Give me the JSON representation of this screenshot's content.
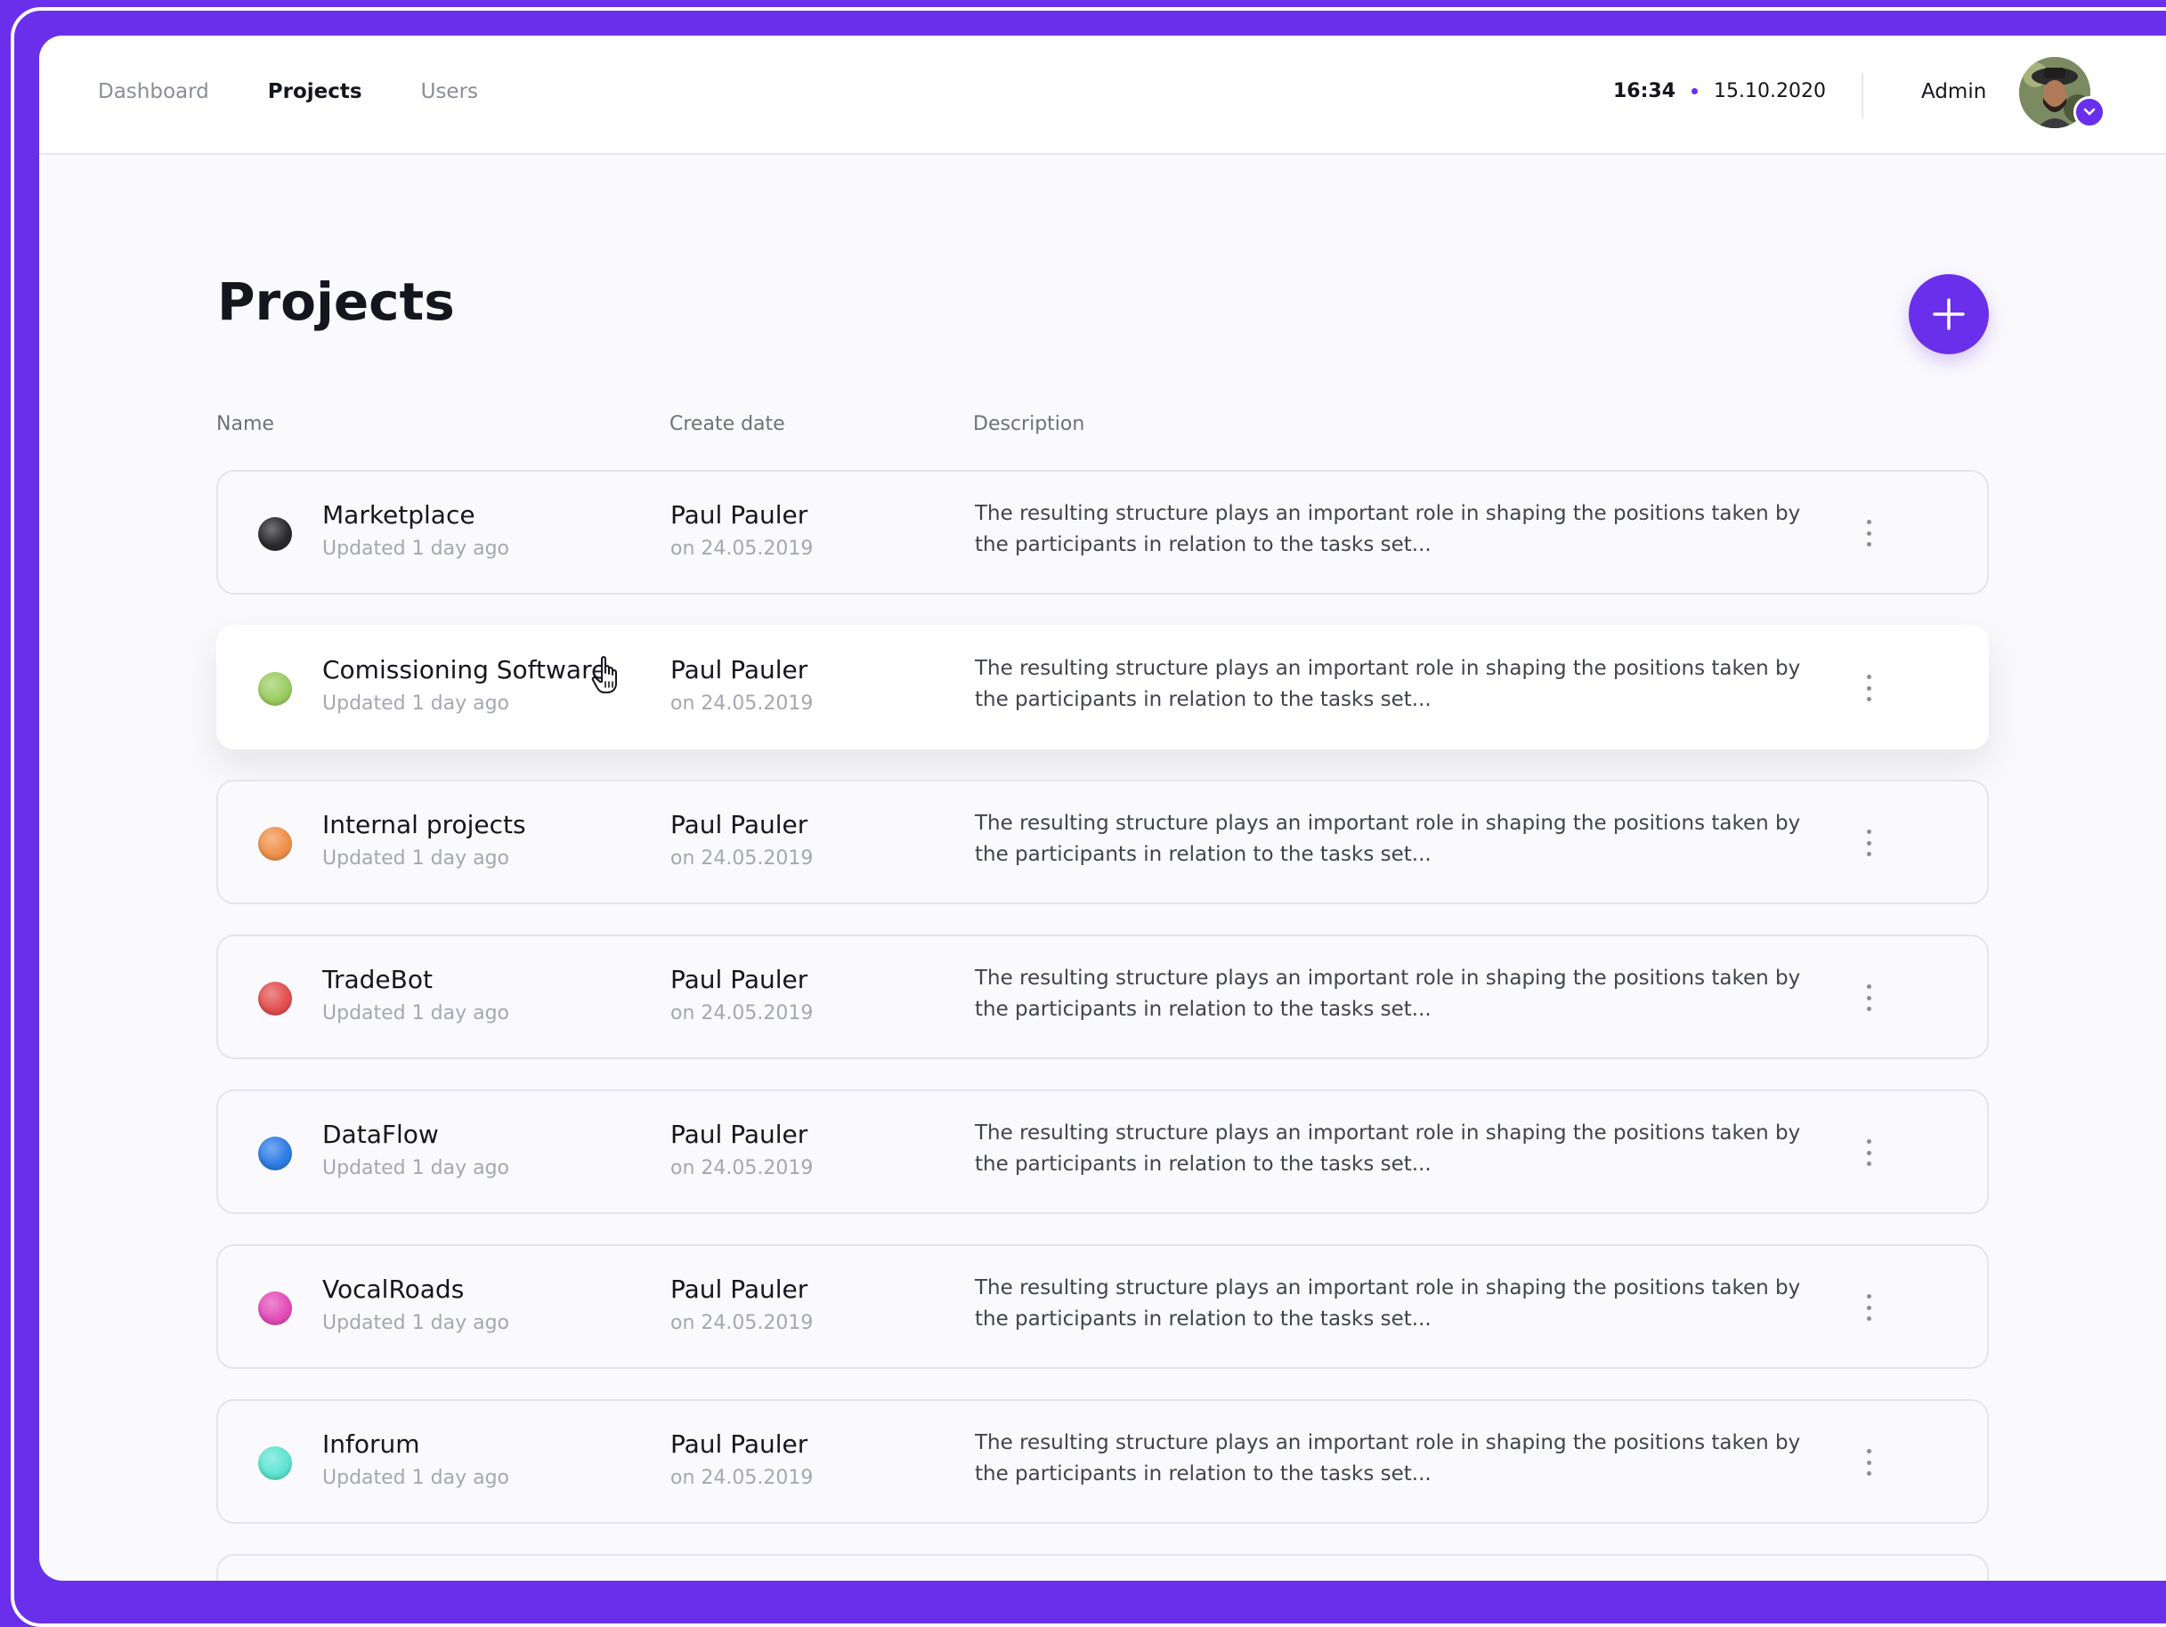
{
  "nav": {
    "items": [
      {
        "label": "Dashboard",
        "active": false
      },
      {
        "label": "Projects",
        "active": true
      },
      {
        "label": "Users",
        "active": false
      }
    ]
  },
  "header": {
    "time": "16:34",
    "date": "15.10.2020",
    "user": "Admin",
    "avatar_icon": "user-avatar",
    "dropdown_icon": "chevron-down-icon"
  },
  "page": {
    "title": "Projects",
    "add_icon": "plus-icon"
  },
  "table": {
    "columns": [
      "Name",
      "Create date",
      "Description"
    ],
    "rows": [
      {
        "name": "Marketplace",
        "updated": "Updated 1 day ago",
        "author": "Paul Pauler",
        "date": "on 24.05.2019",
        "description": "The resulting structure plays an important role in shaping the positions taken by the participants in relation to the tasks set...",
        "color": "#2a2a2f"
      },
      {
        "name": "Comissioning Software",
        "updated": "Updated 1 day ago",
        "author": "Paul Pauler",
        "date": "on 24.05.2019",
        "description": "The resulting structure plays an important role in shaping the positions taken by the participants in relation to the tasks set...",
        "color": "#9ccd62"
      },
      {
        "name": "Internal projects",
        "updated": "Updated 1 day ago",
        "author": "Paul Pauler",
        "date": "on 24.05.2019",
        "description": "The resulting structure plays an important role in shaping the positions taken by the participants in relation to the tasks set...",
        "color": "#f0914a"
      },
      {
        "name": "TradeBot",
        "updated": "Updated 1 day ago",
        "author": "Paul Pauler",
        "date": "on 24.05.2019",
        "description": "The resulting structure plays an important role in shaping the positions taken by the participants in relation to the tasks set...",
        "color": "#e34f50"
      },
      {
        "name": "DataFlow",
        "updated": "Updated 1 day ago",
        "author": "Paul Pauler",
        "date": "on 24.05.2019",
        "description": "The resulting structure plays an important role in shaping the positions taken by the participants in relation to the tasks set...",
        "color": "#2e7de6"
      },
      {
        "name": "VocalRoads",
        "updated": "Updated 1 day ago",
        "author": "Paul Pauler",
        "date": "on 24.05.2019",
        "description": "The resulting structure plays an important role in shaping the positions taken by the participants in relation to the tasks set...",
        "color": "#e34db9"
      },
      {
        "name": "Inforum",
        "updated": "Updated 1 day ago",
        "author": "Paul Pauler",
        "date": "on 24.05.2019",
        "description": "The resulting structure plays an important role in shaping the positions taken by the participants in relation to the tasks set...",
        "color": "#5ee4d2"
      }
    ],
    "row_menu_icon": "more-vertical-icon"
  },
  "colors": {
    "accent": "#6a2fea",
    "background": "#fafafc",
    "text": "#15161d",
    "muted": "#a5a7b1"
  }
}
